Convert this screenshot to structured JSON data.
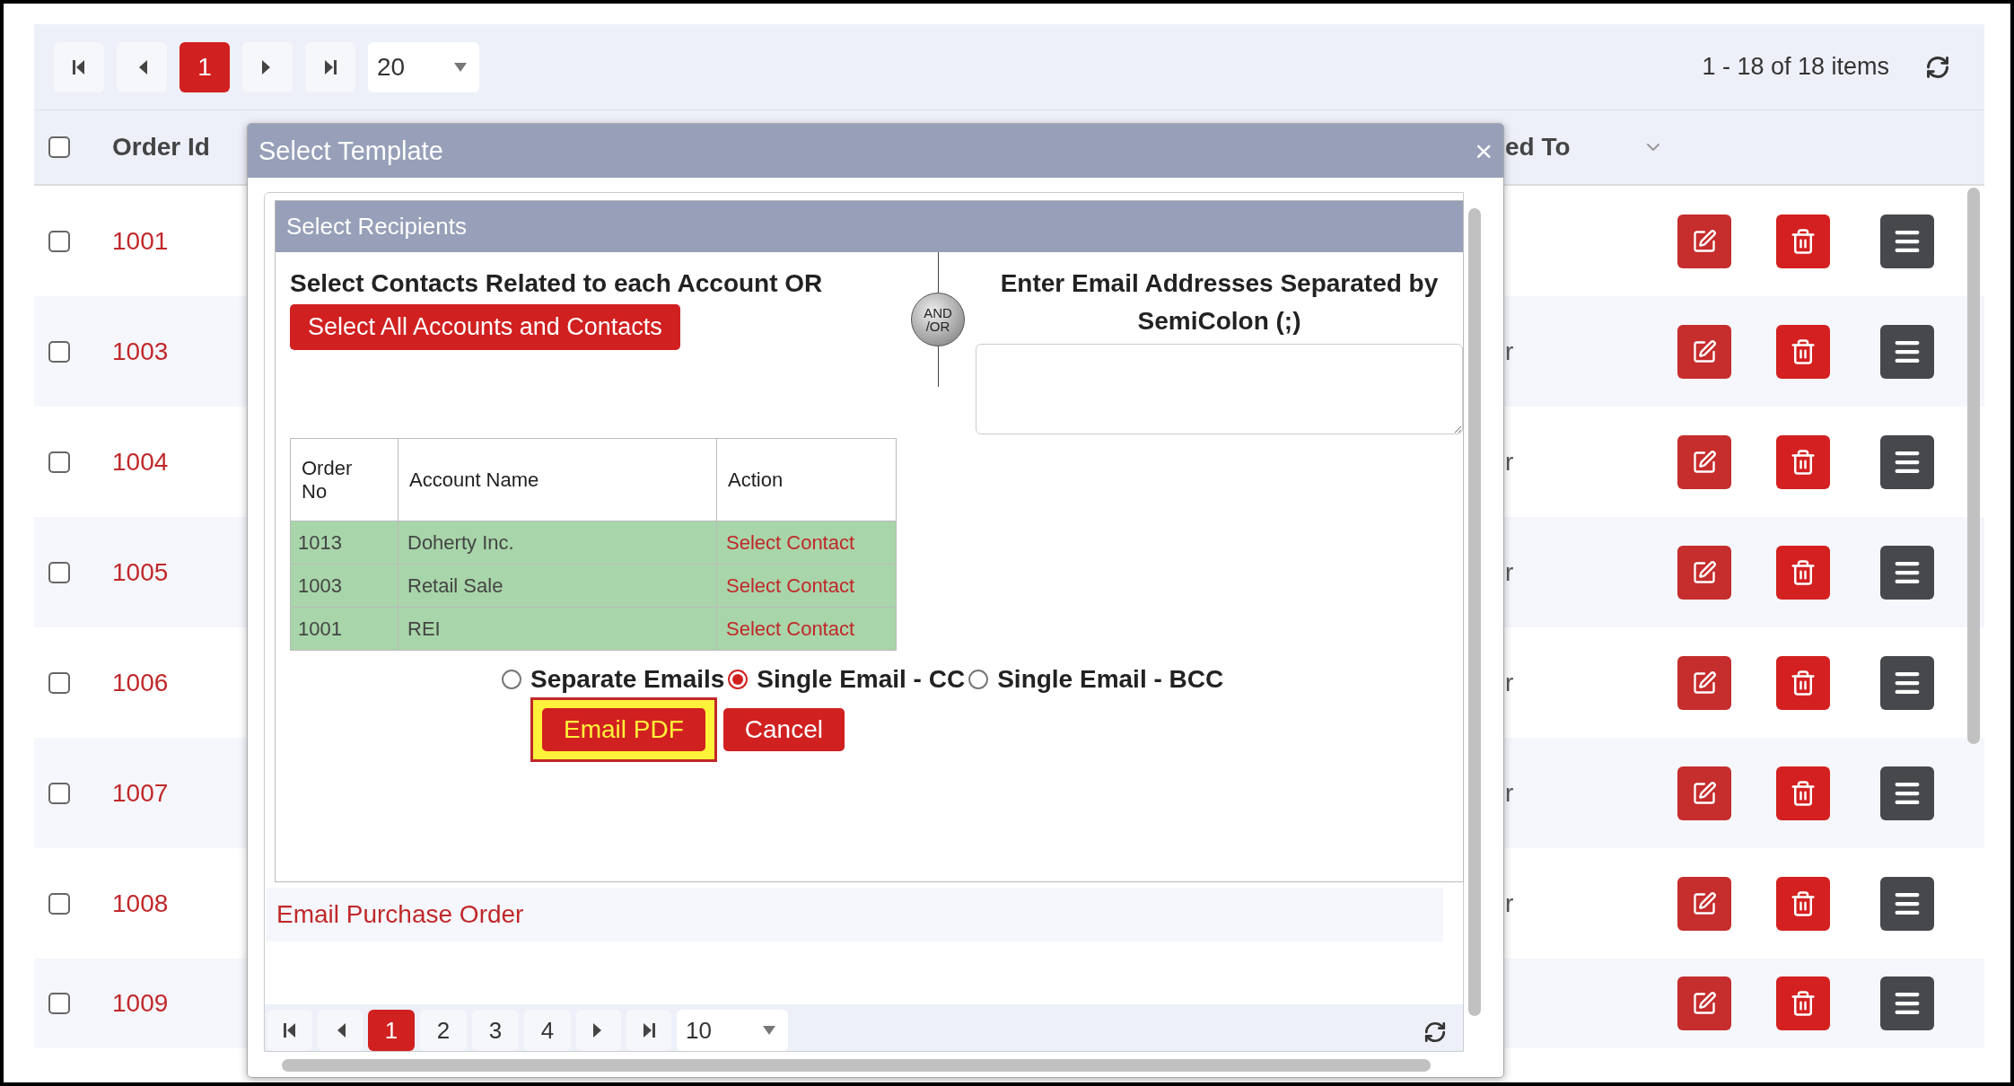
{
  "toolbar": {
    "pages": [
      {
        "label": "1",
        "selected": true
      }
    ],
    "page_size": "20",
    "summary": "1 - 18 of 18 items"
  },
  "table": {
    "header_checked": false,
    "columns": [
      {
        "label": "Order Id"
      },
      {
        "label": "ed To"
      }
    ],
    "rows": [
      {
        "order_id": "1001",
        "checked": false
      },
      {
        "order_id": "1003",
        "checked": false,
        "column_3": "r"
      },
      {
        "order_id": "1004",
        "checked": false,
        "column_3": "r"
      },
      {
        "order_id": "1005",
        "checked": false,
        "column_3": "r"
      },
      {
        "order_id": "1006",
        "checked": false,
        "column_3": "r"
      },
      {
        "order_id": "1007",
        "checked": false,
        "column_3": "r"
      },
      {
        "order_id": "1008",
        "checked": false,
        "column_3": "r"
      },
      {
        "order_id": "1009",
        "checked": false
      }
    ]
  },
  "modal": {
    "title": "Select Template",
    "close": "×",
    "panel_title": "Select Recipients",
    "left_heading": "Select Contacts Related to each Account OR",
    "select_all_button": "Select All Accounts and Contacts",
    "divider_badge": [
      "AND",
      "/OR"
    ],
    "right_heading": "Enter Email Addresses Separated by SemiColon (;)",
    "accounts_table": {
      "columns": [
        "Order No",
        "Account Name",
        "Action"
      ],
      "rows": [
        {
          "order_no": "1013",
          "account_name": "Doherty Inc.",
          "action": "Select Contact"
        },
        {
          "order_no": "1003",
          "account_name": "Retail Sale",
          "action": "Select Contact"
        },
        {
          "order_no": "1001",
          "account_name": "REI",
          "action": "Select Contact"
        }
      ]
    },
    "delivery_options": [
      {
        "label": "Separate Emails",
        "selected": false
      },
      {
        "label": "Single Email - CC",
        "selected": true
      },
      {
        "label": "Single Email - BCC",
        "selected": false
      }
    ],
    "buttons": [
      {
        "label": "Email PDF",
        "highlighted": true
      },
      {
        "label": "Cancel",
        "highlighted": false
      }
    ],
    "template_link": "Email Purchase Order",
    "pager": {
      "pages": [
        {
          "label": "1",
          "selected": true
        },
        {
          "label": "2",
          "selected": false
        },
        {
          "label": "3",
          "selected": false
        },
        {
          "label": "4",
          "selected": false
        }
      ],
      "page_size": "10"
    }
  }
}
